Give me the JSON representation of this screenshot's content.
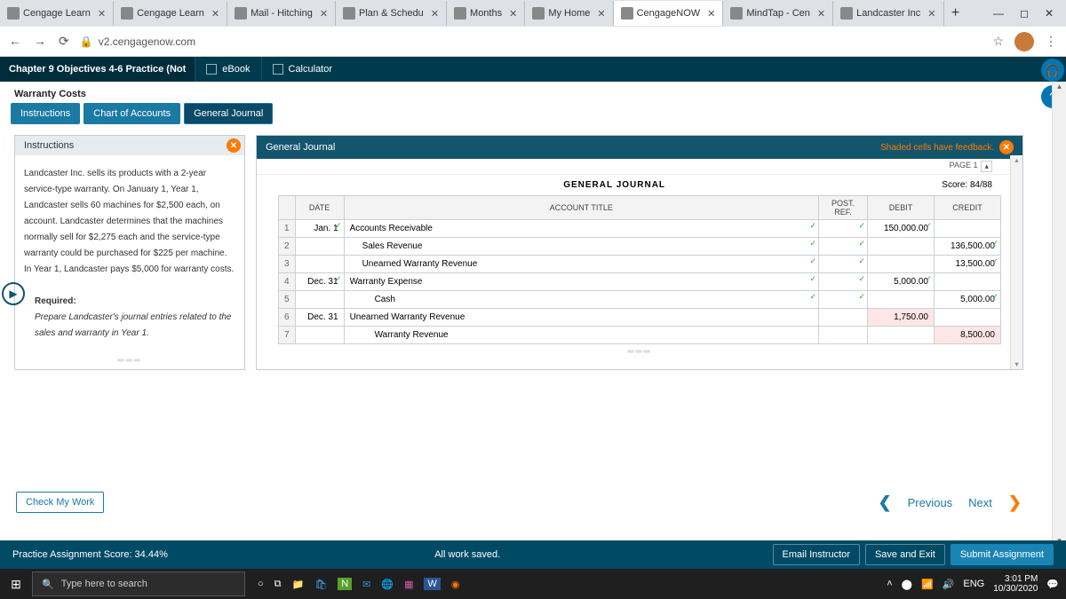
{
  "browser": {
    "tabs": [
      {
        "label": "Cengage Learn"
      },
      {
        "label": "Cengage Learn"
      },
      {
        "label": "Mail - Hitching"
      },
      {
        "label": "Plan & Schedu"
      },
      {
        "label": "Months"
      },
      {
        "label": "My Home"
      },
      {
        "label": "CengageNOW",
        "active": true
      },
      {
        "label": "MindTap - Cen"
      },
      {
        "label": "Landcaster Inc"
      }
    ],
    "url": "v2.cengagenow.com"
  },
  "assignment": {
    "title": "Chapter 9 Objectives 4-6 Practice (Not",
    "ebook": "eBook",
    "calculator": "Calculator",
    "section": "Warranty Costs",
    "subtabs": [
      "Instructions",
      "Chart of Accounts",
      "General Journal"
    ],
    "active_subtab": 2
  },
  "instructions": {
    "header": "Instructions",
    "text": "Landcaster Inc. sells its products with a 2-year service-type warranty. On January 1, Year 1, Landcaster sells 60 machines for $2,500 each, on account. Landcaster determines that the machines normally sell for $2,275 each and the service-type warranty could be purchased for $225 per machine. In Year 1, Landcaster pays $5,000 for warranty costs.",
    "required_label": "Required:",
    "required_text": "Prepare Landcaster's journal entries related to the sales and warranty in Year 1."
  },
  "journal": {
    "header": "General Journal",
    "feedback": "Shaded cells have feedback.",
    "page": "PAGE 1",
    "title": "GENERAL JOURNAL",
    "score": "Score: 84/88",
    "cols": [
      "DATE",
      "ACCOUNT TITLE",
      "POST. REF.",
      "DEBIT",
      "CREDIT"
    ],
    "rows": [
      {
        "n": "1",
        "date": "Jan. 1",
        "title": "Accounts Receivable",
        "indent": 0,
        "debit": "150,000.00",
        "credit": "",
        "ok": true
      },
      {
        "n": "2",
        "date": "",
        "title": "Sales Revenue",
        "indent": 1,
        "debit": "",
        "credit": "136,500.00",
        "ok": true
      },
      {
        "n": "3",
        "date": "",
        "title": "Unearned Warranty Revenue",
        "indent": 1,
        "debit": "",
        "credit": "13,500.00",
        "ok": true
      },
      {
        "n": "4",
        "date": "Dec. 31",
        "title": "Warranty Expense",
        "indent": 0,
        "debit": "5,000.00",
        "credit": "",
        "ok": true
      },
      {
        "n": "5",
        "date": "",
        "title": "Cash",
        "indent": 2,
        "debit": "",
        "credit": "5,000.00",
        "ok": true
      },
      {
        "n": "6",
        "date": "Dec. 31",
        "title": "Unearned Warranty Revenue",
        "indent": 0,
        "debit": "1,750.00",
        "credit": "",
        "err": true
      },
      {
        "n": "7",
        "date": "",
        "title": "Warranty Revenue",
        "indent": 2,
        "debit": "",
        "credit": "8,500.00",
        "err": true
      }
    ]
  },
  "bottom": {
    "check": "Check My Work",
    "previous": "Previous",
    "next": "Next"
  },
  "footer": {
    "score": "Practice Assignment Score: 34.44%",
    "saved": "All work saved.",
    "email": "Email Instructor",
    "save": "Save and Exit",
    "submit": "Submit Assignment"
  },
  "taskbar": {
    "search": "Type here to search",
    "lang": "ENG",
    "time": "3:01 PM",
    "date": "10/30/2020"
  }
}
